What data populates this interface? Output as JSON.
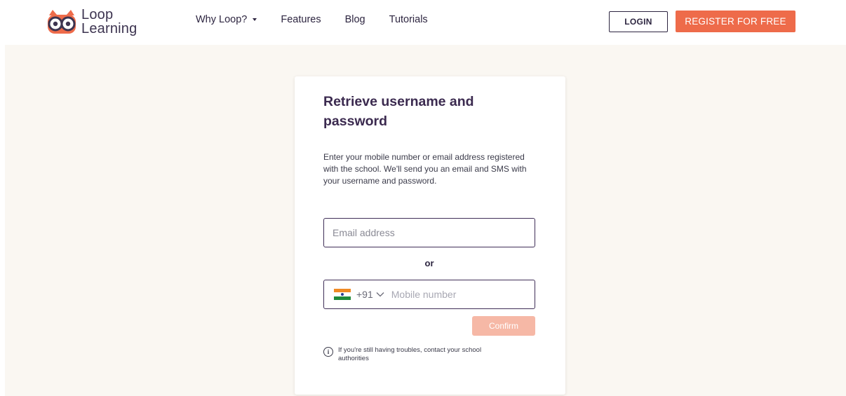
{
  "brand": {
    "name_line1": "Loop",
    "name_line2": "Learning",
    "accent_color": "#ee6b4a",
    "primary_color": "#3b2a4f"
  },
  "nav": {
    "items": [
      {
        "label": "Why Loop?",
        "has_dropdown": true,
        "icon": "caret-down-icon"
      },
      {
        "label": "Features"
      },
      {
        "label": "Blog"
      },
      {
        "label": "Tutorials"
      }
    ],
    "login_label": "LOGIN",
    "register_label": "REGISTER FOR FREE"
  },
  "card": {
    "title": "Retrieve username and password",
    "description": "Enter your mobile number or email address registered with the school. We'll send you an email and SMS with your username and password.",
    "email_placeholder": "Email address",
    "or_label": "or",
    "phone": {
      "country_flag": "india-flag-icon",
      "dial_code": "+91",
      "placeholder": "Mobile number"
    },
    "confirm_label": "Confirm",
    "help_text": "If you're still having troubles, contact your school authorities",
    "help_icon": "info-icon"
  }
}
